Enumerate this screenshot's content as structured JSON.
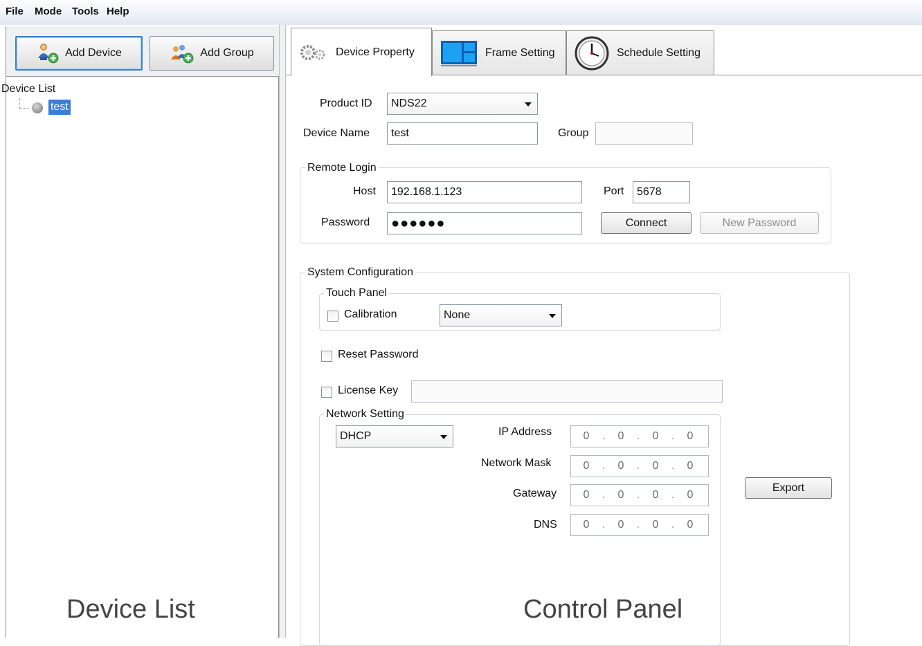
{
  "menu": [
    "File",
    "Mode",
    "Tools",
    "Help"
  ],
  "toolbar": {
    "add_device": "Add Device",
    "add_group": "Add Group"
  },
  "device_list": {
    "header": "Device List",
    "items": [
      {
        "label": "test",
        "selected": true
      }
    ],
    "caption": "Device List"
  },
  "tabs": [
    {
      "label": "Device Property",
      "active": true
    },
    {
      "label": "Frame Setting",
      "active": false
    },
    {
      "label": "Schedule Setting",
      "active": false
    }
  ],
  "device_property": {
    "product_id_label": "Product ID",
    "product_id_value": "NDS22",
    "device_name_label": "Device Name",
    "device_name_value": "test",
    "group_label": "Group",
    "group_value": "",
    "remote_login": {
      "title": "Remote Login",
      "host_label": "Host",
      "host_value": "192.168.1.123",
      "port_label": "Port",
      "port_value": "5678",
      "password_label": "Password",
      "password_value": "●●●●●●",
      "connect": "Connect",
      "new_password": "New Password"
    },
    "system_configuration": {
      "title": "System Configuration",
      "touch_panel": {
        "title": "Touch Panel",
        "calibration_label": "Calibration",
        "calibration_value": "None"
      },
      "reset_password": "Reset Password",
      "license_key": "License Key",
      "license_key_value": "",
      "network_setting": {
        "title": "Network Setting",
        "mode": "DHCP",
        "ip_address_label": "IP Address",
        "network_mask_label": "Network Mask",
        "gateway_label": "Gateway",
        "dns_label": "DNS",
        "ip_address": [
          "0",
          "0",
          "0",
          "0"
        ],
        "network_mask": [
          "0",
          "0",
          "0",
          "0"
        ],
        "gateway": [
          "0",
          "0",
          "0",
          "0"
        ],
        "dns": [
          "0",
          "0",
          "0",
          "0"
        ]
      },
      "export": "Export"
    },
    "caption": "Control Panel"
  },
  "colors": {
    "selection": "#3b7dd8",
    "menubar": "#e8ecf5",
    "focus_border": "#3d82c8"
  }
}
